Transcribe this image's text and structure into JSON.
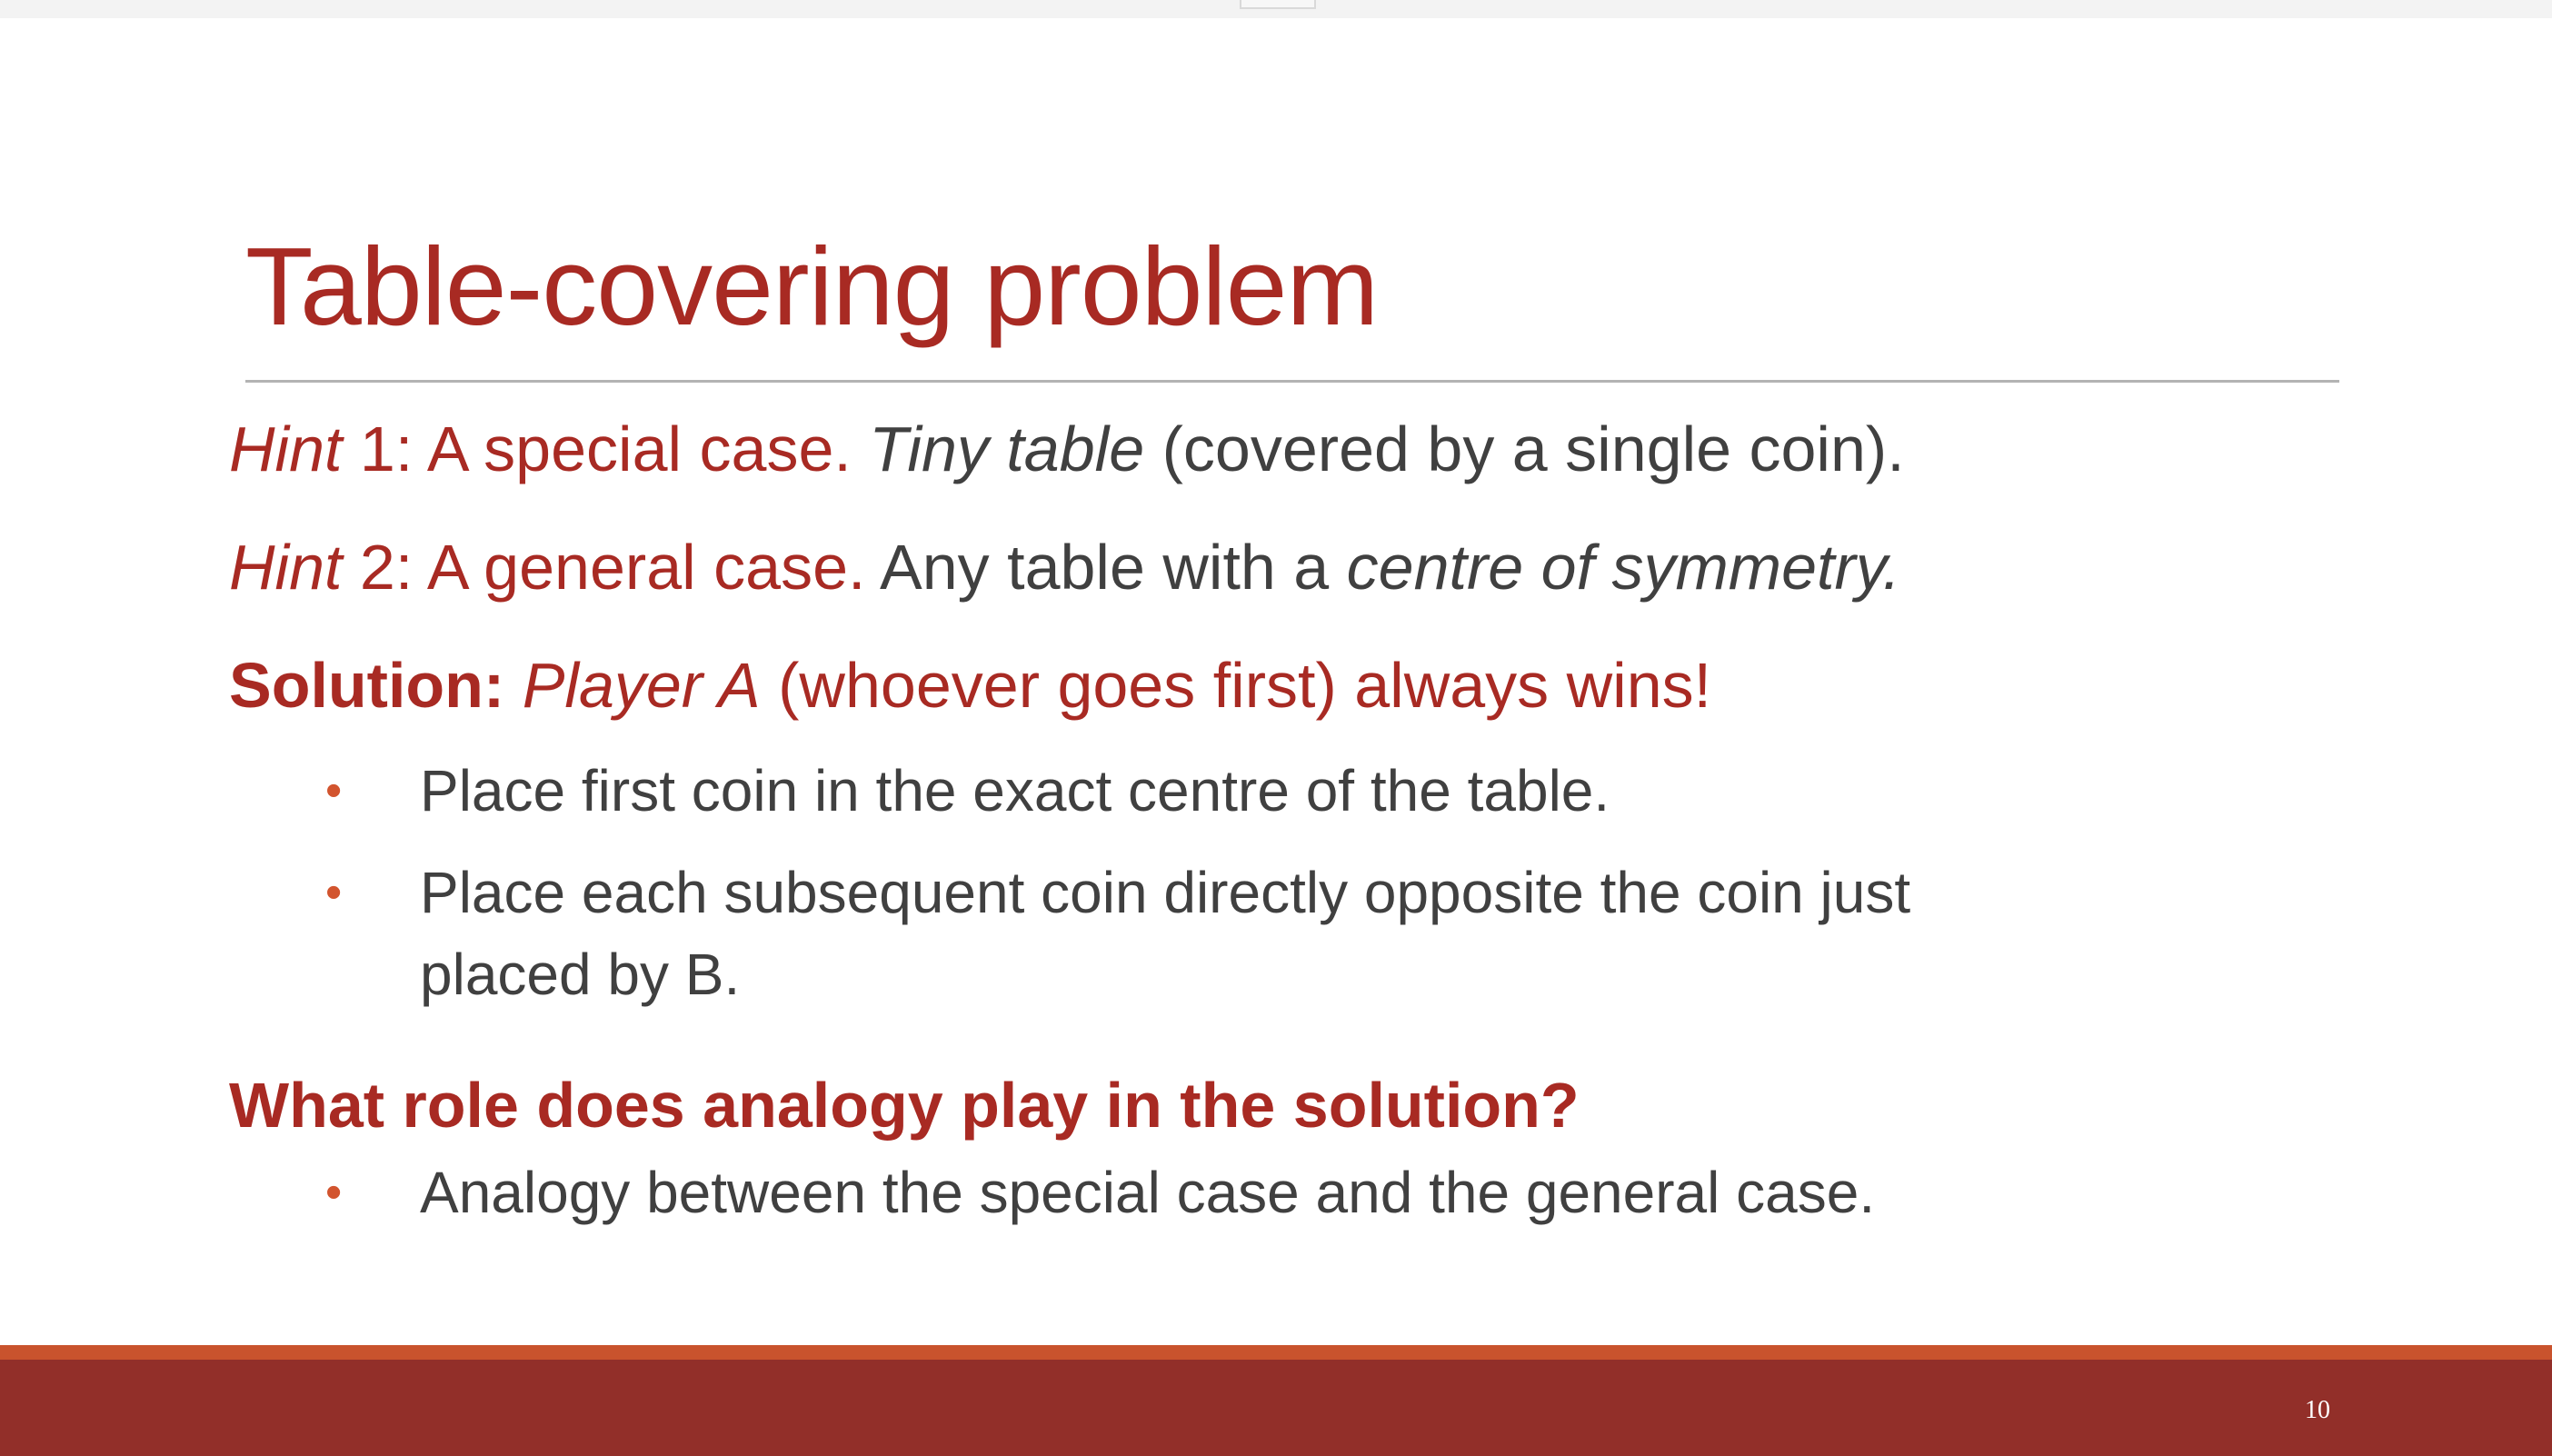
{
  "slide": {
    "title": "Table-covering problem",
    "hint1": {
      "label": "Hint",
      "number_text": " 1: A special case. ",
      "emph": "Tiny table",
      "rest": " (covered by a single coin)."
    },
    "hint2": {
      "label": "Hint",
      "number_text": " 2: A general case. ",
      "plain": "Any table with a ",
      "emph": "centre of symmetry."
    },
    "solution": {
      "label": "Solution: ",
      "emph": "Player A",
      "rest": " (whoever goes first) always wins!"
    },
    "solution_bullets": [
      {
        "lines": [
          "Place first coin in the exact centre of the table."
        ]
      },
      {
        "lines": [
          "Place each subsequent coin directly opposite the coin just",
          "placed by B."
        ]
      }
    ],
    "question": "What role does analogy play in the solution?",
    "question_bullets": [
      {
        "lines": [
          "Analogy between the special case and the general case."
        ]
      }
    ],
    "bullet_glyph": "•",
    "page_number": "10"
  },
  "colors": {
    "accent_red": "#a82a23",
    "bullet_orange": "#d2542e",
    "footer_dark": "#922f29",
    "footer_accent": "#c9532d",
    "body_text": "#404040"
  }
}
